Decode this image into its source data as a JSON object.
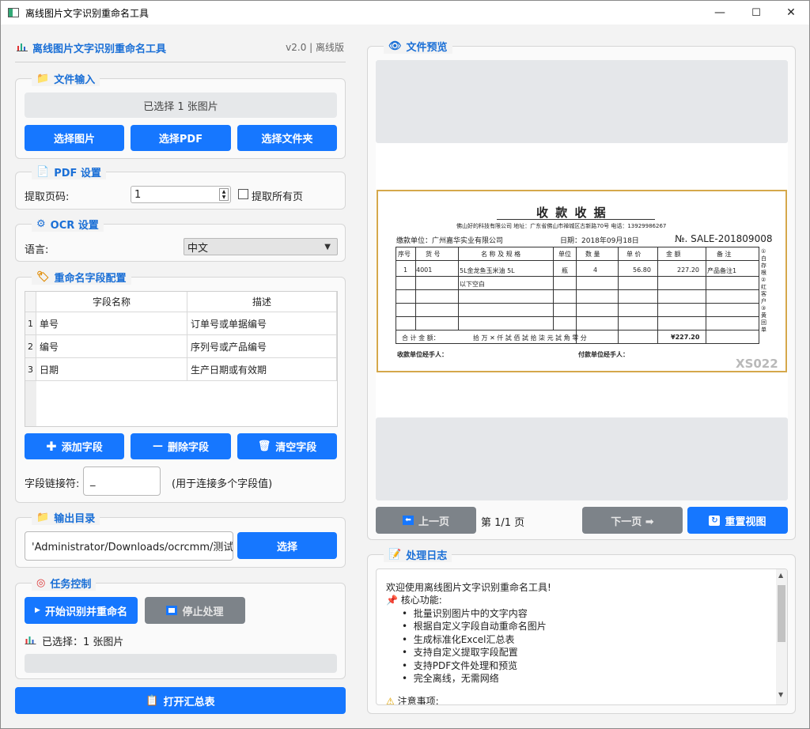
{
  "window": {
    "title": "离线图片文字识别重命名工具",
    "min": "—",
    "max": "☐",
    "close": "✕"
  },
  "header": {
    "title": "离线图片文字识别重命名工具",
    "version": "v2.0 | 离线版"
  },
  "file_input": {
    "title": "文件输入",
    "status": "已选择 1 张图片",
    "btn_images": "选择图片",
    "btn_pdf": "选择PDF",
    "btn_folder": "选择文件夹"
  },
  "pdf": {
    "title": "PDF 设置",
    "page_label": "提取页码:",
    "page_value": "1",
    "all_pages_label": "提取所有页"
  },
  "ocr": {
    "title": "OCR 设置",
    "lang_label": "语言:",
    "lang_value": "中文"
  },
  "rename": {
    "title": "重命名字段配置",
    "col_name": "字段名称",
    "col_desc": "描述",
    "rows": [
      {
        "idx": "1",
        "name": "单号",
        "desc": "订单号或单据编号"
      },
      {
        "idx": "2",
        "name": "编号",
        "desc": "序列号或产品编号"
      },
      {
        "idx": "3",
        "name": "日期",
        "desc": "生产日期或有效期"
      }
    ],
    "btn_add": "添加字段",
    "btn_del": "删除字段",
    "btn_clear": "清空字段",
    "sep_label": "字段链接符:",
    "sep_value": "_",
    "sep_hint": "(用于连接多个字段值)"
  },
  "output": {
    "title": "输出目录",
    "path": "'Administrator/Downloads/ocrcmm/测试",
    "btn": "选择"
  },
  "task": {
    "title": "任务控制",
    "btn_start": "开始识别并重命名",
    "btn_stop": "停止处理",
    "selected": "已选择：1 张图片"
  },
  "open_summary": "打开汇总表",
  "preview": {
    "title": "文件预览",
    "btn_prev": "上一页",
    "page_info": "第 1/1 页",
    "btn_next": "下一页 ➡",
    "btn_reset": "重置视图"
  },
  "receipt": {
    "heading": "收 款 收 据",
    "company": "佛山好的科技有限公司  地址：广东省佛山市禅城区古新路70号  电话：13929986267",
    "payer": "缴款单位：广州嘉华实业有限公司",
    "date": "日期：2018年09月18日",
    "number": "№. SALE-201809008",
    "cols": [
      "序号",
      "货  号",
      "名 称 及 规 格",
      "单位",
      "数  量",
      "单  价",
      "金    额",
      "备    注"
    ],
    "row": [
      "1",
      "4001",
      "5L金龙鱼玉米油 5L",
      "瓶",
      "4",
      "56.80",
      "227.20",
      "产品备注1"
    ],
    "empty_note": "以下空白",
    "total_label": "合 计 金 额：",
    "total_words": "拾    万 ✕ 仟  試 佰  試 拾  柒 元  試 角 零 分",
    "total_value": "¥227.20",
    "sign_left": "收款单位经手人：",
    "sign_right": "付款单位经手人：",
    "side_marks": "①白存根 ②红客户 ③黄回单",
    "code": "XS022"
  },
  "log": {
    "title": "处理日志",
    "welcome": "欢迎使用离线图片文字识别重命名工具!",
    "features_title": "核心功能:",
    "features": [
      "批量识别图片中的文字内容",
      "根据自定义字段自动重命名图片",
      "生成标准化Excel汇总表",
      "支持自定义提取字段配置",
      "支持PDF文件处理和预览",
      "完全离线，无需网络"
    ],
    "notes_title": "注意事项:"
  },
  "colors": {
    "accent": "#1677ff",
    "title_blue": "#1a6fd6",
    "disabled": "#7d8389"
  }
}
